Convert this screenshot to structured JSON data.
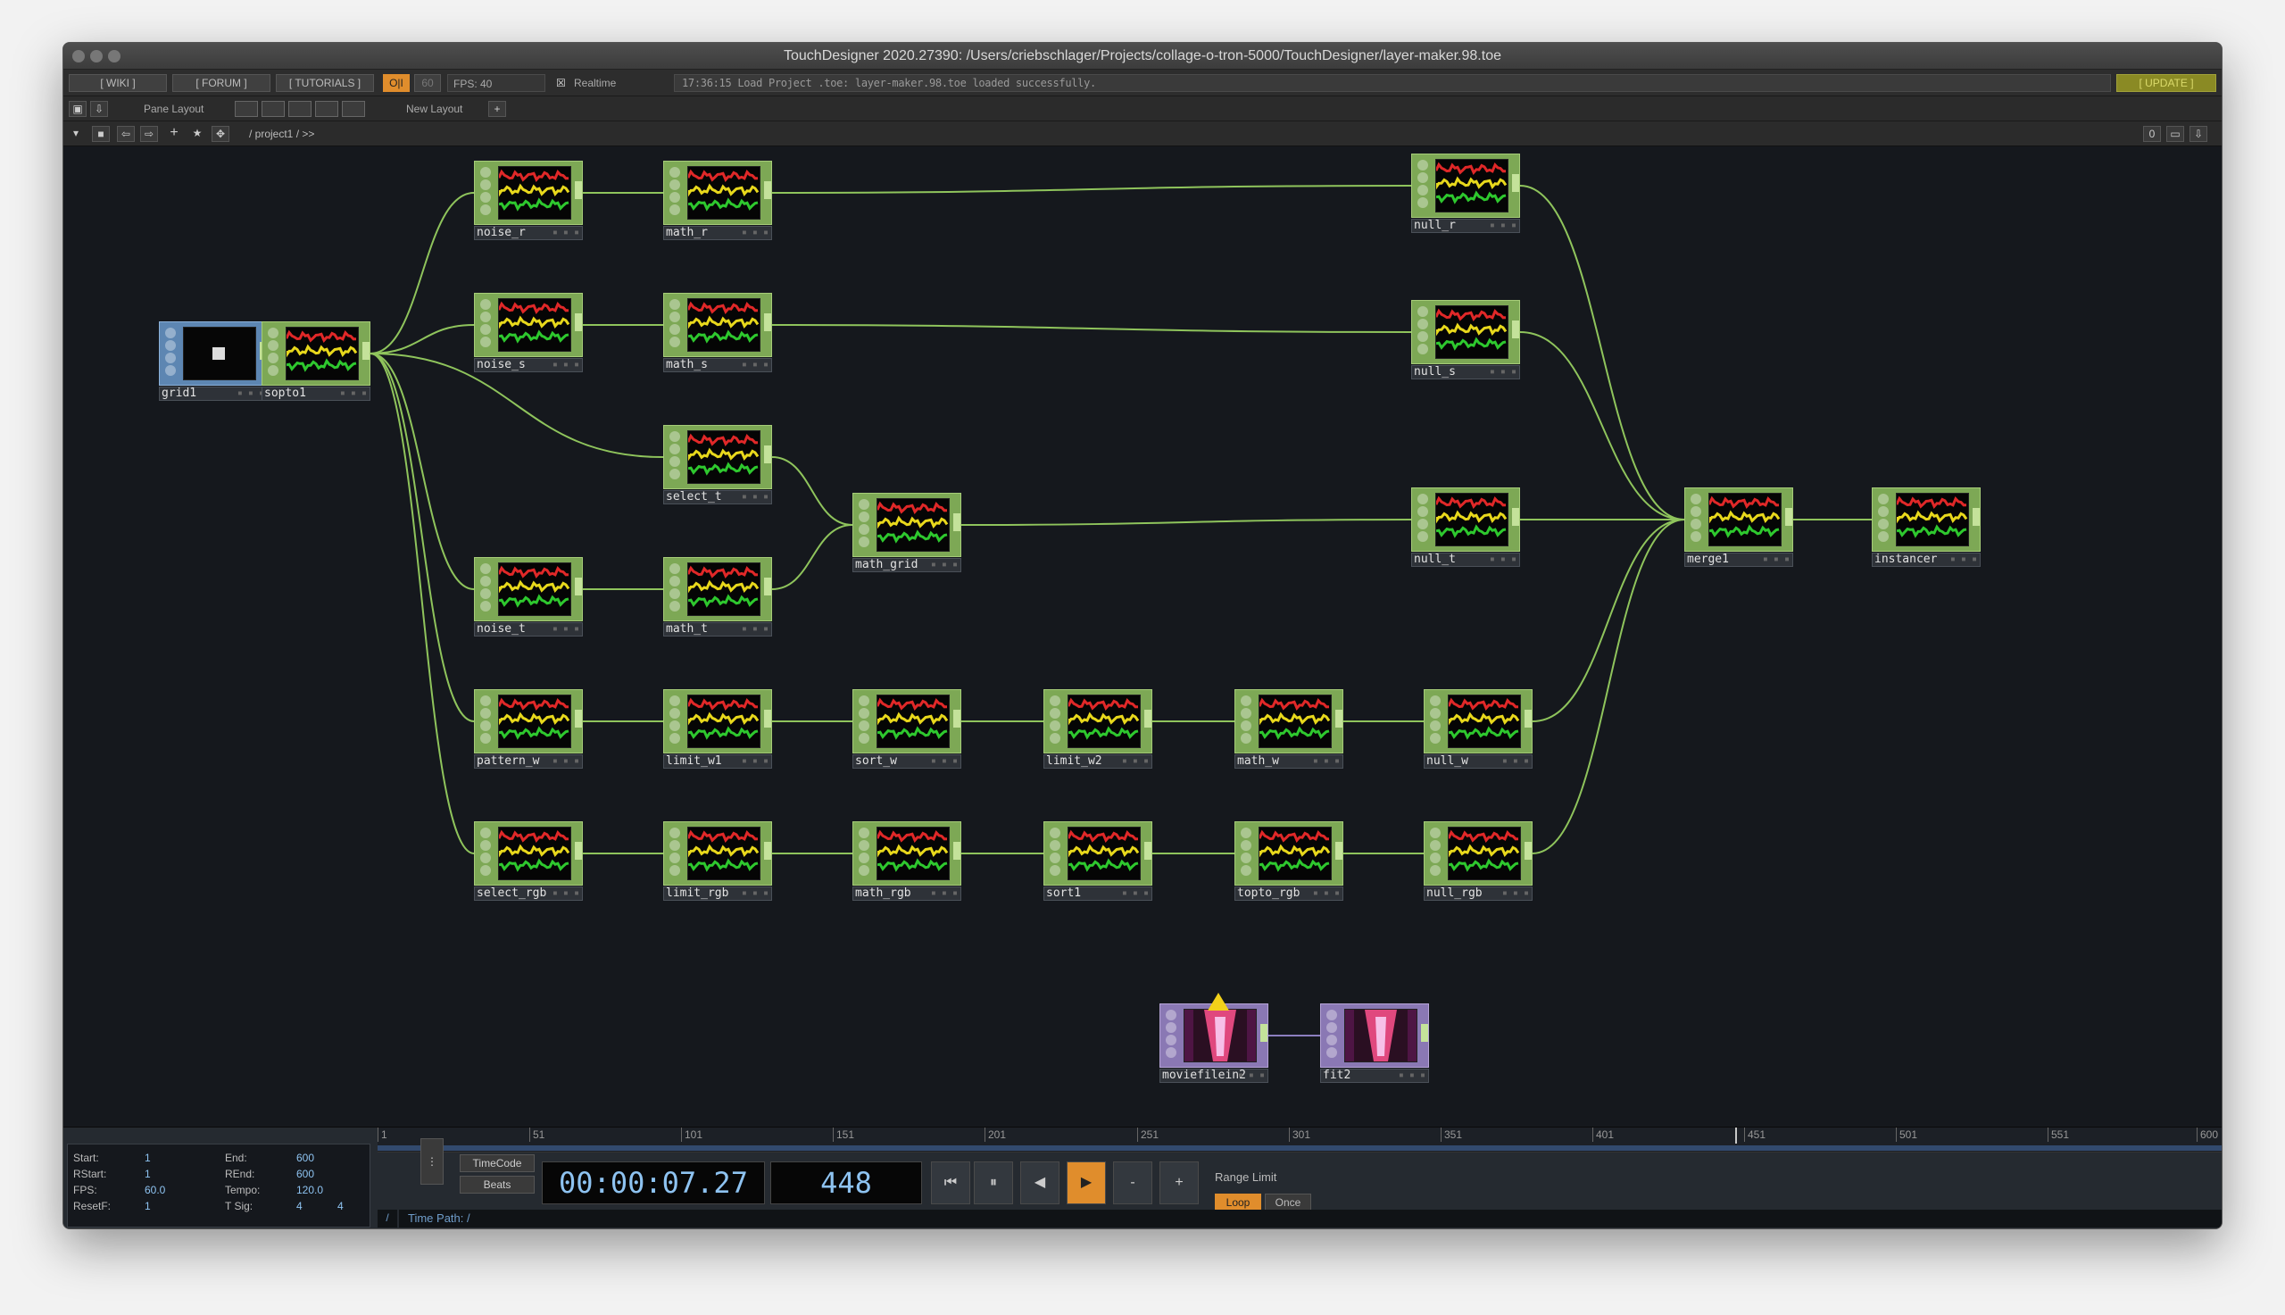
{
  "window": {
    "title": "TouchDesigner 2020.27390: /Users/criebschlager/Projects/collage-o-tron-5000/TouchDesigner/layer-maker.98.toe",
    "controls": [
      "close",
      "minimize",
      "zoom"
    ]
  },
  "toolbar": {
    "wiki": "[ WIKI ]",
    "forum": "[ FORUM ]",
    "tutorials": "[ TUTORIALS ]",
    "oi": "O|I",
    "fps_cap": "60",
    "fps": "FPS:  40",
    "realtime": "Realtime",
    "realtime_checked": "☒",
    "status": "17:36:15 Load Project .toe: layer-maker.98.toe loaded successfully.",
    "update": "[ UPDATE ]"
  },
  "panebar": {
    "pane_layout": "Pane Layout",
    "new_layout": "New Layout",
    "add": "+"
  },
  "pathbar": {
    "path": "/ project1 / >>",
    "counter": "0"
  },
  "nodes": [
    {
      "id": "grid1",
      "type": "sop"
    },
    {
      "id": "sopto1",
      "type": "chop"
    },
    {
      "id": "noise_r",
      "type": "chop"
    },
    {
      "id": "math_r",
      "type": "chop"
    },
    {
      "id": "null_r",
      "type": "chop"
    },
    {
      "id": "noise_s",
      "type": "chop"
    },
    {
      "id": "math_s",
      "type": "chop"
    },
    {
      "id": "null_s",
      "type": "chop"
    },
    {
      "id": "select_t",
      "type": "chop"
    },
    {
      "id": "math_grid",
      "type": "chop"
    },
    {
      "id": "null_t",
      "type": "chop"
    },
    {
      "id": "noise_t",
      "type": "chop"
    },
    {
      "id": "math_t",
      "type": "chop"
    },
    {
      "id": "merge1",
      "type": "chop"
    },
    {
      "id": "instancer",
      "type": "chop"
    },
    {
      "id": "pattern_w",
      "type": "chop"
    },
    {
      "id": "limit_w1",
      "type": "chop"
    },
    {
      "id": "sort_w",
      "type": "chop"
    },
    {
      "id": "limit_w2",
      "type": "chop"
    },
    {
      "id": "math_w",
      "type": "chop"
    },
    {
      "id": "null_w",
      "type": "chop"
    },
    {
      "id": "select_rgb",
      "type": "chop"
    },
    {
      "id": "limit_rgb",
      "type": "chop"
    },
    {
      "id": "math_rgb",
      "type": "chop"
    },
    {
      "id": "sort1",
      "type": "chop"
    },
    {
      "id": "topto_rgb",
      "type": "chop"
    },
    {
      "id": "null_rgb",
      "type": "chop"
    },
    {
      "id": "moviefilein2",
      "type": "top",
      "warning": true
    },
    {
      "id": "fit2",
      "type": "top"
    }
  ],
  "timeline": {
    "info": {
      "start_k": "Start:",
      "start_v": "1",
      "end_k": "End:",
      "end_v": "600",
      "rstart_k": "RStart:",
      "rstart_v": "1",
      "rend_k": "REnd:",
      "rend_v": "600",
      "fps_k": "FPS:",
      "fps_v": "60.0",
      "tempo_k": "Tempo:",
      "tempo_v": "120.0",
      "resetf_k": "ResetF:",
      "resetf_v": "1",
      "tsig_k": "T Sig:",
      "tsig_a": "4",
      "tsig_b": "4"
    },
    "ticks": [
      "1",
      "51",
      "101",
      "151",
      "201",
      "251",
      "301",
      "351",
      "401",
      "451",
      "501",
      "551",
      "600"
    ],
    "playhead_frame": 448,
    "timecode_label": "TimeCode",
    "beats_label": "Beats",
    "timecode": "00:00:07.27",
    "frame": "448",
    "transport": {
      "rewind": "⏮",
      "pause": "⏸",
      "back": "◀",
      "play": "▶",
      "minus": "-",
      "plus": "+"
    },
    "range_limit": "Range Limit",
    "loop": "Loop",
    "once": "Once",
    "time_path": "Time Path: /",
    "slash": "/"
  },
  "colors": {
    "chop": "#7da855",
    "top": "#8a78b4",
    "sop": "#5d86b2",
    "wire": "#8fc45c",
    "wire_top": "#8c7fbf",
    "accent": "#e08d2c"
  }
}
